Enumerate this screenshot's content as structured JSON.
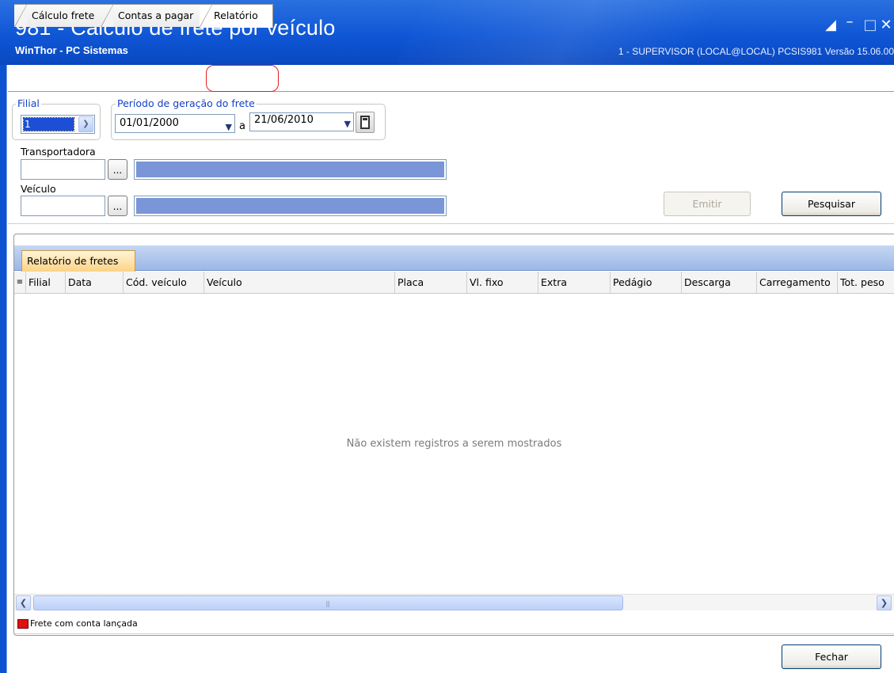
{
  "window": {
    "title": "981 - Cálculo de frete por veículo",
    "subtitle": "WinThor - PC Sistemas",
    "session": "1 - SUPERVISOR (LOCAL@LOCAL)   PCSIS981   Versão 15.06.00"
  },
  "tabs": [
    {
      "label": "Cálculo frete"
    },
    {
      "label": "Contas a pagar"
    },
    {
      "label": "Relatório",
      "selected": true
    }
  ],
  "filters": {
    "filial_label": "Filial",
    "filial_value": "1",
    "periodo_label": "Período de geração do frete",
    "date_from": "01/01/2000",
    "date_separator": "a",
    "date_to": "21/06/2010",
    "transportadora_label": "Transportadora",
    "veiculo_label": "Veículo",
    "browse_label": "..."
  },
  "buttons": {
    "emitir": "Emitir",
    "pesquisar": "Pesquisar",
    "fechar": "Fechar"
  },
  "grid": {
    "tab_label": "Relatório de fretes",
    "columns": [
      "Filial",
      "Data",
      "Cód. veículo",
      "Veículo",
      "Placa",
      "Vl. fixo",
      "Extra",
      "Pedágio",
      "Descarga",
      "Carregamento",
      "Tot. peso"
    ],
    "empty_message": "Não existem registros a serem mostrados"
  },
  "legend": {
    "text": "Frete com conta lançada",
    "color": "#e01010"
  }
}
